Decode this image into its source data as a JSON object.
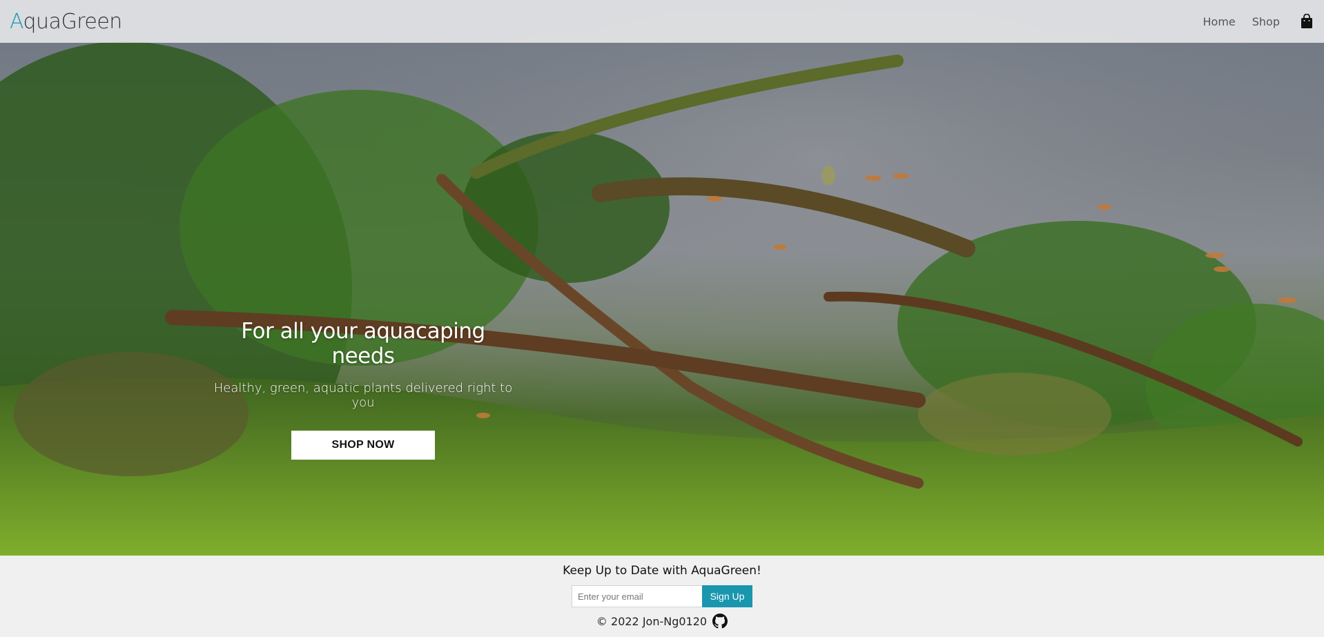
{
  "navbar": {
    "brand_first": "A",
    "brand_rest": "quaGreen",
    "links": [
      "Home",
      "Shop"
    ],
    "cart_icon": "shopping-bag-icon"
  },
  "hero": {
    "title": "For all your aquacaping needs",
    "subtitle": "Healthy, green, aquatic plants delivered right to you",
    "cta_label": "SHOP NOW"
  },
  "footer": {
    "newsletter_title": "Keep Up to Date with AquaGreen!",
    "email_placeholder": "Enter your email",
    "signup_label": "Sign Up",
    "copyright": "© 2022 Jon-Ng0120",
    "github_icon": "github-icon"
  },
  "colors": {
    "accent": "#1a96ae",
    "brand_a": "#1a9bb0"
  }
}
